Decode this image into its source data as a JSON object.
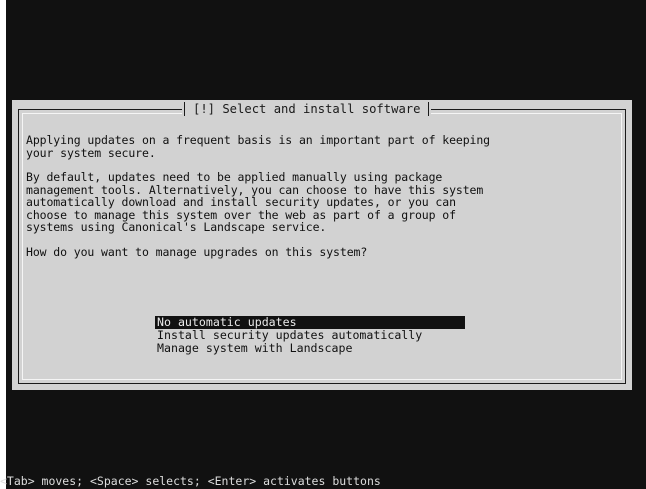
{
  "dialog": {
    "title": "[!] Select and install software",
    "paragraph1": "Applying updates on a frequent basis is an important part of keeping\nyour system secure.",
    "paragraph2": "By default, updates need to be applied manually using package\nmanagement tools. Alternatively, you can choose to have this system\nautomatically download and install security updates, or you can\nchoose to manage this system over the web as part of a group of\nsystems using Canonical's Landscape service.",
    "question": "How do you want to manage upgrades on this system?",
    "options": [
      {
        "label": "No automatic updates",
        "selected": true
      },
      {
        "label": "Install security updates automatically",
        "selected": false
      },
      {
        "label": "Manage system with Landscape",
        "selected": false
      }
    ]
  },
  "help_text": "<Tab> moves; <Space> selects; <Enter> activates buttons",
  "colors": {
    "background": "#111111",
    "dialog": "#d2d2d2",
    "text": "#101010",
    "selection": "#111111"
  }
}
